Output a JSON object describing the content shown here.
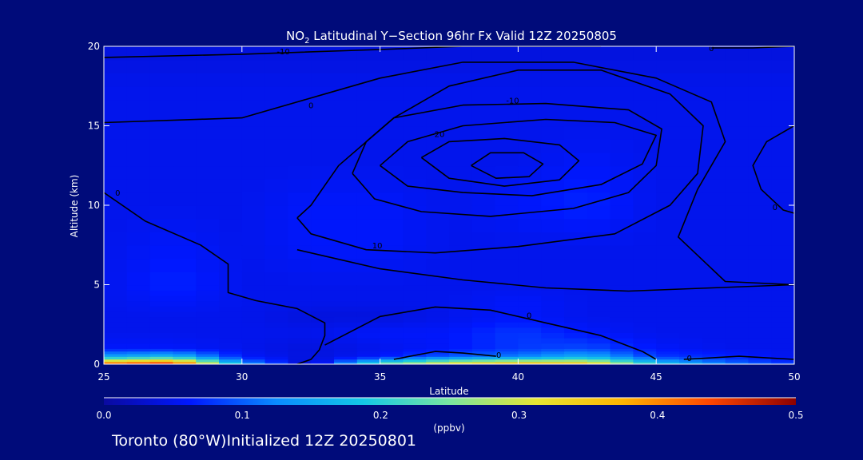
{
  "footer_text": "Toronto (80°W)Initialized 12Z 20250801",
  "colors": {
    "background": "#000b7a",
    "text": "#ffffff",
    "contour": "#000000",
    "colormap": [
      "#0a0aa0",
      "#0018ff",
      "#0a8cff",
      "#14c8e6",
      "#7ae6a0",
      "#e6e632",
      "#ffb400",
      "#ff4600",
      "#8c0000"
    ]
  },
  "chart_data": {
    "type": "heatmap",
    "title_prefix": "NO",
    "title_subscript": "2",
    "title_rest": " Latitudinal Y−Section 96hr  Fx Valid 12Z 20250805",
    "xlabel": "Latitude",
    "ylabel": "Altitude (km)",
    "xlim": [
      25,
      50
    ],
    "ylim": [
      0,
      20
    ],
    "xticks": [
      "25",
      "30",
      "35",
      "40",
      "45",
      "50"
    ],
    "yticks": [
      "0",
      "5",
      "10",
      "15",
      "20"
    ],
    "colorbar": {
      "label": "(ppbv)",
      "range": [
        0.0,
        0.5
      ],
      "ticks": [
        "0.0",
        "0.1",
        "0.2",
        "0.3",
        "0.4",
        "0.5"
      ]
    },
    "field": {
      "lat": [
        25,
        27.5,
        30,
        32.5,
        35,
        37.5,
        40,
        42.5,
        45,
        47.5,
        50
      ],
      "alt": [
        0,
        0.5,
        1,
        2,
        3,
        4,
        5,
        7.5,
        10,
        12.5,
        15,
        17.5,
        20
      ],
      "values": [
        [
          0.45,
          0.5,
          0.15,
          0.02,
          0.25,
          0.35,
          0.4,
          0.38,
          0.2,
          0.12,
          0.08
        ],
        [
          0.15,
          0.18,
          0.06,
          0.04,
          0.06,
          0.1,
          0.12,
          0.16,
          0.08,
          0.07,
          0.05
        ],
        [
          0.06,
          0.06,
          0.05,
          0.04,
          0.05,
          0.06,
          0.08,
          0.09,
          0.06,
          0.05,
          0.05
        ],
        [
          0.05,
          0.05,
          0.05,
          0.05,
          0.06,
          0.06,
          0.08,
          0.06,
          0.05,
          0.05,
          0.05
        ],
        [
          0.05,
          0.05,
          0.05,
          0.04,
          0.04,
          0.05,
          0.06,
          0.05,
          0.05,
          0.05,
          0.05
        ],
        [
          0.05,
          0.06,
          0.05,
          0.05,
          0.05,
          0.05,
          0.06,
          0.05,
          0.05,
          0.05,
          0.05
        ],
        [
          0.05,
          0.07,
          0.05,
          0.05,
          0.05,
          0.05,
          0.05,
          0.05,
          0.05,
          0.05,
          0.05
        ],
        [
          0.05,
          0.06,
          0.05,
          0.06,
          0.06,
          0.05,
          0.05,
          0.05,
          0.05,
          0.05,
          0.05
        ],
        [
          0.05,
          0.05,
          0.05,
          0.06,
          0.06,
          0.05,
          0.06,
          0.07,
          0.05,
          0.05,
          0.05
        ],
        [
          0.05,
          0.05,
          0.05,
          0.05,
          0.05,
          0.05,
          0.05,
          0.06,
          0.05,
          0.05,
          0.05
        ],
        [
          0.05,
          0.05,
          0.05,
          0.05,
          0.05,
          0.05,
          0.05,
          0.05,
          0.05,
          0.05,
          0.05
        ],
        [
          0.05,
          0.05,
          0.05,
          0.05,
          0.05,
          0.05,
          0.05,
          0.05,
          0.05,
          0.05,
          0.05
        ],
        [
          0.04,
          0.04,
          0.04,
          0.04,
          0.04,
          0.04,
          0.04,
          0.04,
          0.04,
          0.04,
          0.04
        ]
      ]
    },
    "contours": [
      {
        "label": "-10",
        "points": [
          [
            25,
            19.3
          ],
          [
            30,
            19.5
          ],
          [
            35,
            19.8
          ],
          [
            38,
            20
          ],
          [
            43,
            20
          ]
        ],
        "label_at": [
          31.5,
          19.7
        ]
      },
      {
        "label": "0",
        "points": [
          [
            47,
            19.9
          ],
          [
            48.5,
            19.9
          ],
          [
            50,
            20
          ]
        ],
        "label_at": [
          47,
          19.9
        ]
      },
      {
        "label": "0",
        "points": [
          [
            25,
            15.2
          ],
          [
            30,
            15.5
          ],
          [
            33,
            17
          ],
          [
            35,
            18
          ],
          [
            38,
            19
          ],
          [
            42,
            19
          ],
          [
            45,
            18
          ],
          [
            47,
            16.5
          ],
          [
            47.5,
            14
          ],
          [
            46.5,
            11
          ],
          [
            45.8,
            8
          ],
          [
            47.5,
            5.2
          ],
          [
            50,
            5
          ]
        ],
        "label_at": [
          32.5,
          16.3
        ]
      },
      {
        "label": "0",
        "points": [
          [
            25,
            10.8
          ],
          [
            26.5,
            9
          ],
          [
            28.5,
            7.5
          ],
          [
            29.5,
            6.3
          ],
          [
            29.5,
            4.5
          ],
          [
            30.5,
            4
          ],
          [
            32,
            3.5
          ],
          [
            33,
            2.6
          ],
          [
            33,
            1.8
          ],
          [
            32.8,
            0.9
          ],
          [
            32.5,
            0.3
          ],
          [
            32,
            0
          ]
        ],
        "label_at": [
          25.5,
          10.8
        ]
      },
      {
        "label": "0",
        "points": [
          [
            50,
            15
          ],
          [
            49,
            14
          ],
          [
            48.5,
            12.5
          ],
          [
            48.8,
            11
          ],
          [
            49.6,
            9.7
          ],
          [
            50,
            9.5
          ]
        ],
        "label_at": [
          49.3,
          9.9
        ]
      },
      {
        "label": "-10",
        "points": [
          [
            32,
            9.2
          ],
          [
            32.5,
            10
          ],
          [
            33.5,
            12.5
          ],
          [
            35.5,
            15.5
          ],
          [
            37.5,
            17.5
          ],
          [
            40,
            18.5
          ],
          [
            43,
            18.5
          ],
          [
            45.5,
            17
          ],
          [
            46.7,
            15
          ],
          [
            46.5,
            12
          ],
          [
            45.5,
            10
          ],
          [
            43.5,
            8.2
          ],
          [
            40,
            7.4
          ],
          [
            37,
            7
          ],
          [
            34.5,
            7.2
          ],
          [
            32.5,
            8.2
          ],
          [
            32,
            9.2
          ]
        ],
        "label_at": [
          39.8,
          16.6
        ]
      },
      {
        "label": "-20",
        "points": [
          [
            34,
            12
          ],
          [
            34.5,
            14
          ],
          [
            35.5,
            15.5
          ],
          [
            38,
            16.3
          ],
          [
            41,
            16.4
          ],
          [
            44,
            16
          ],
          [
            45.2,
            14.8
          ],
          [
            45,
            12.5
          ],
          [
            44,
            10.8
          ],
          [
            42,
            9.8
          ],
          [
            39,
            9.3
          ],
          [
            36.5,
            9.6
          ],
          [
            34.8,
            10.4
          ],
          [
            34,
            12
          ]
        ],
        "label_at": [
          37.1,
          14.5
        ]
      },
      {
        "label": "",
        "points": [
          [
            35,
            12.5
          ],
          [
            36,
            14
          ],
          [
            38,
            15
          ],
          [
            41,
            15.4
          ],
          [
            43.5,
            15.2
          ],
          [
            45,
            14.4
          ],
          [
            44.5,
            12.6
          ],
          [
            43,
            11.3
          ],
          [
            40.5,
            10.6
          ],
          [
            38,
            10.8
          ],
          [
            36,
            11.2
          ],
          [
            35,
            12.5
          ]
        ],
        "label_at": [
          40,
          15.2
        ]
      },
      {
        "label": "",
        "points": [
          [
            36.5,
            13
          ],
          [
            37.5,
            14
          ],
          [
            39.5,
            14.2
          ],
          [
            41.5,
            13.8
          ],
          [
            42.2,
            12.8
          ],
          [
            41.5,
            11.6
          ],
          [
            39.5,
            11.2
          ],
          [
            37.5,
            11.7
          ],
          [
            36.5,
            13
          ]
        ],
        "label_at": [
          39.5,
          14
        ]
      },
      {
        "label": "",
        "points": [
          [
            38.3,
            12.5
          ],
          [
            39,
            13.3
          ],
          [
            40.2,
            13.3
          ],
          [
            40.9,
            12.6
          ],
          [
            40.4,
            11.8
          ],
          [
            39.2,
            11.7
          ],
          [
            38.3,
            12.5
          ]
        ],
        "label_at": [
          39.5,
          13.1
        ]
      },
      {
        "label": "10",
        "points": [
          [
            32,
            7.2
          ],
          [
            33,
            6.8
          ],
          [
            35,
            6
          ],
          [
            38,
            5.3
          ],
          [
            41,
            4.8
          ],
          [
            44,
            4.6
          ],
          [
            47,
            4.8
          ],
          [
            50,
            5
          ]
        ],
        "label_at": [
          34.9,
          7.5
        ]
      },
      {
        "label": "0",
        "points": [
          [
            33,
            1.2
          ],
          [
            35,
            3
          ],
          [
            37,
            3.6
          ],
          [
            39,
            3.4
          ],
          [
            41,
            2.6
          ],
          [
            43,
            1.8
          ],
          [
            44.5,
            0.8
          ],
          [
            45,
            0.3
          ]
        ],
        "label_at": [
          40.4,
          3.1
        ]
      },
      {
        "label": "0",
        "points": [
          [
            35.5,
            0.3
          ],
          [
            37,
            0.8
          ],
          [
            38,
            0.7
          ],
          [
            39.2,
            0.5
          ]
        ],
        "label_at": [
          39.3,
          0.6
        ]
      },
      {
        "label": "0",
        "points": [
          [
            46,
            0.3
          ],
          [
            48,
            0.5
          ],
          [
            50,
            0.3
          ]
        ],
        "label_at": [
          46.2,
          0.4
        ]
      }
    ]
  }
}
